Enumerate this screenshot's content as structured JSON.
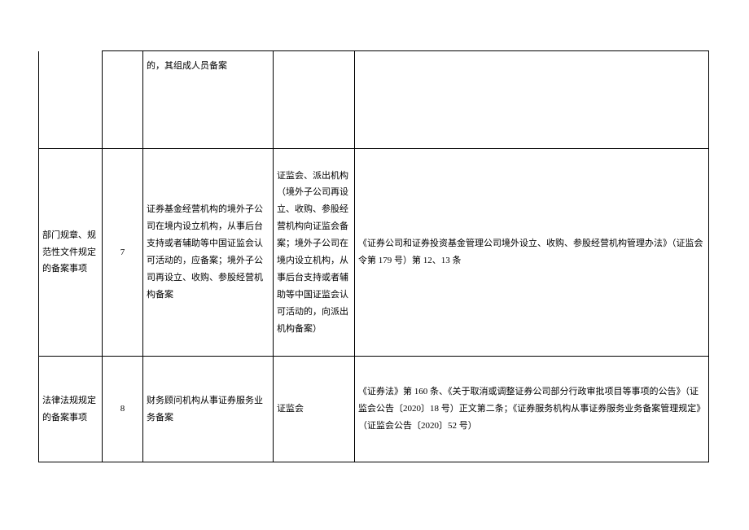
{
  "table": {
    "rows": [
      {
        "col1": "",
        "col2": "",
        "col3": "的，其组成人员备案",
        "col4": "",
        "col5": ""
      },
      {
        "col1": "部门规章、规范性文件规定的备案事项",
        "col2": "7",
        "col3": "证券基金经营机构的境外子公司在境内设立机构，从事后台支持或者辅助等中国证监会认可活动的，应备案；境外子公司再设立、收购、参股经营机构备案",
        "col4": "证监会、派出机构（境外子公司再设立、收购、参股经营机构向证监会备案；境外子公司在境内设立机构，从事后台支持或者辅助等中国证监会认可活动的，向派出机构备案）",
        "col5": "《证券公司和证券投资基金管理公司境外设立、收购、参股经营机构管理办法》（证监会令第 179 号）第 12、13 条"
      },
      {
        "col1": "法律法规规定的备案事项",
        "col2": "8",
        "col3": "财务顾问机构从事证券服务业务备案",
        "col4": "证监会",
        "col5": "《证券法》第 160 条、《关于取消或调整证券公司部分行政审批项目等事项的公告》（证监会公告〔2020〕18 号）正文第二条；《证券服务机构从事证券服务业务备案管理规定》（证监会公告〔2020〕52 号）"
      }
    ]
  }
}
